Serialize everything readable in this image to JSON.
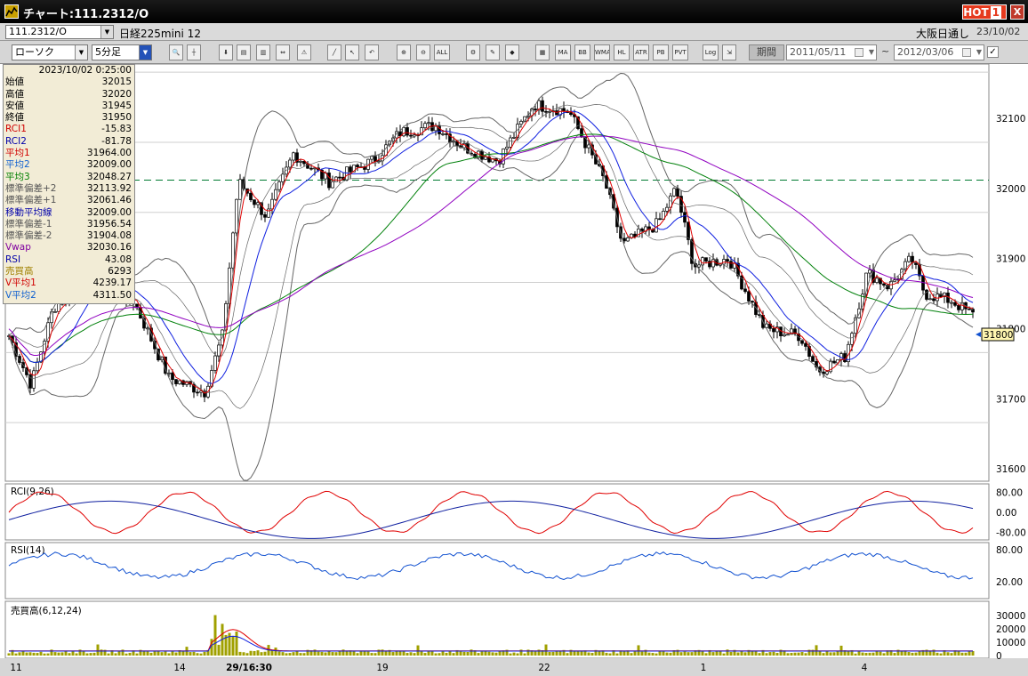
{
  "window": {
    "title": "チャート:111.2312/O",
    "hot_label": "HOT",
    "hot_number": "1",
    "close_label": "X"
  },
  "symbol_bar": {
    "symbol": "111.2312/O",
    "name": "日経225mini 12",
    "market": "大阪日通し",
    "date": "23/10/02"
  },
  "toolbar": {
    "chart_type": "ローソク",
    "interval": "5分足",
    "buttons": [
      "zoom-icon",
      "cursor-icon",
      "download-icon",
      "print-icon",
      "chart-settings-icon",
      "compare-icon",
      "alert-icon",
      "draw-line-icon",
      "select-arrow-icon",
      "undo-icon",
      "add-indicator-icon",
      "remove-indicator-icon",
      "all-indicators",
      "settings-icon",
      "eraser-icon",
      "color-icon",
      "grid-icon",
      "ma-indicator",
      "bb-indicator",
      "wma-indicator",
      "hl-indicator",
      "atr-indicator",
      "pb-indicator",
      "pvt-indicator",
      "log-scale",
      "export-icon"
    ],
    "button_labels": {
      "all": "ALL",
      "ma": "MA",
      "bb": "BB",
      "wma": "WMA",
      "hl": "HL",
      "atr": "ATR",
      "pb": "PB",
      "pvt": "PVT",
      "log": "Log"
    },
    "period_label": "期間",
    "date_from": "2011/05/11",
    "date_tilde": "~",
    "date_to": "2012/03/06",
    "apply_check": "✓"
  },
  "info_panel": {
    "timestamp": "2023/10/02  0:25:00",
    "rows": [
      {
        "label": "始値",
        "value": "32015",
        "color": "#000"
      },
      {
        "label": "高値",
        "value": "32020",
        "color": "#000"
      },
      {
        "label": "安値",
        "value": "31945",
        "color": "#000"
      },
      {
        "label": "終値",
        "value": "31950",
        "color": "#000"
      },
      {
        "label": "RCI1",
        "value": "-15.83",
        "color": "#d00000"
      },
      {
        "label": "RCI2",
        "value": "-81.78",
        "color": "#0000aa"
      },
      {
        "label": "平均1",
        "value": "31964.00",
        "color": "#d00000"
      },
      {
        "label": "平均2",
        "value": "32009.00",
        "color": "#1060d0"
      },
      {
        "label": "平均3",
        "value": "32048.27",
        "color": "#008000"
      },
      {
        "label": "標準偏差+2",
        "value": "32113.92",
        "color": "#555"
      },
      {
        "label": "標準偏差+1",
        "value": "32061.46",
        "color": "#555"
      },
      {
        "label": "移動平均線",
        "value": "32009.00",
        "color": "#0000aa"
      },
      {
        "label": "標準偏差-1",
        "value": "31956.54",
        "color": "#555"
      },
      {
        "label": "標準偏差-2",
        "value": "31904.08",
        "color": "#555"
      },
      {
        "label": "Vwap",
        "value": "32030.16",
        "color": "#8000a0"
      },
      {
        "label": "RSI",
        "value": "43.08",
        "color": "#0000aa"
      },
      {
        "label": "売買高",
        "value": "6293",
        "color": "#a08000"
      },
      {
        "label": "V平均1",
        "value": "4239.17",
        "color": "#d00000"
      },
      {
        "label": "V平均2",
        "value": "4311.50",
        "color": "#1060d0"
      }
    ]
  },
  "chart_data": {
    "type": "candlestick",
    "price_axis": {
      "ticks": [
        "32100",
        "32000",
        "31900",
        "31800",
        "31700",
        "31600"
      ],
      "min": 31600,
      "max": 32100,
      "current_price": "31800",
      "reference_line": 32012
    },
    "x_axis": {
      "ticks": [
        "11",
        "14",
        "29/16:30",
        "19",
        "22",
        "1",
        "4"
      ]
    },
    "rci_panel": {
      "label": "RCI(9,26)",
      "ticks": [
        "80.00",
        "0.00",
        "-80.00"
      ]
    },
    "rsi_panel": {
      "label": "RSI(14)",
      "ticks": [
        "80.00",
        "20.00"
      ]
    },
    "volume_panel": {
      "label": "売買高(6,12,24)",
      "ticks": [
        "30000",
        "20000",
        "10000",
        "0"
      ]
    },
    "colors": {
      "ma_short": "#e00000",
      "ma_mid": "#1020e0",
      "ma_long": "#00800a",
      "vwap": "#9000c0",
      "band": "#666666",
      "rci_long": "#1020a0",
      "rsi": "#1050d0",
      "volume": "#a0a000"
    }
  }
}
